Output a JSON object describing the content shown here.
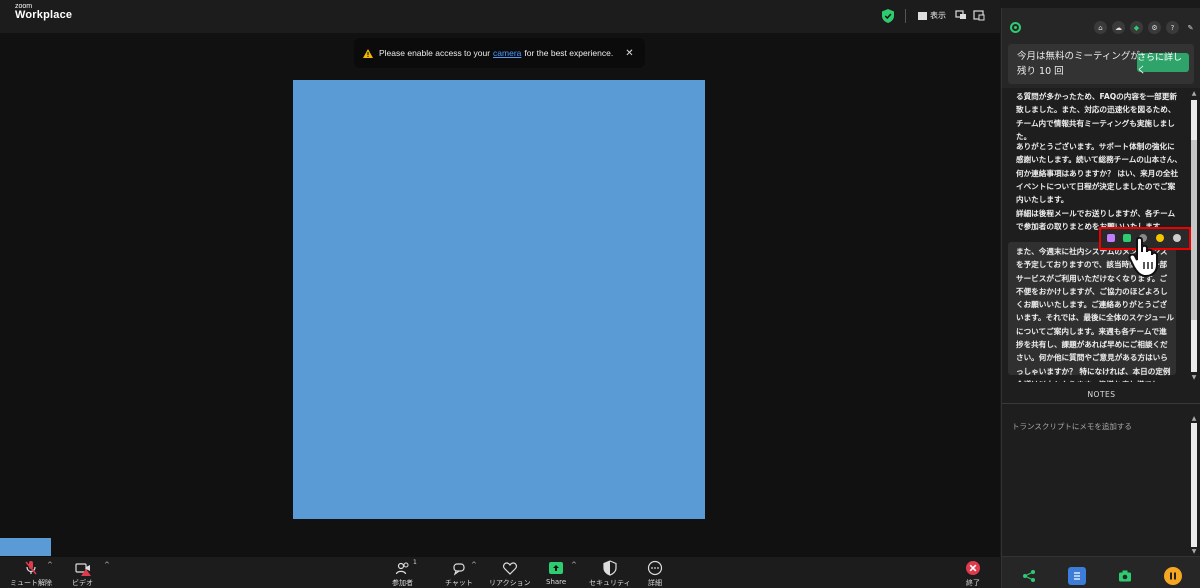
{
  "topbar": {
    "brand_small": "zoom",
    "brand_big": "Workplace",
    "view_label": "表示"
  },
  "notice": {
    "text_before": "Please enable access to your",
    "link": "camera",
    "text_after": "for the best experience.",
    "close": "✕"
  },
  "toolbar": {
    "mute_label": "ミュート解除",
    "video_label": "ビデオ",
    "participants_label": "参加者",
    "participants_count": "1",
    "chat_label": "チャット",
    "reaction_label": "リアクション",
    "share_label": "Share",
    "security_label": "セキュリティ",
    "more_label": "詳細",
    "end_label": "終了"
  },
  "panel": {
    "promo_line1": "今月は無料のミーティングが",
    "promo_line2": "残り 10 回",
    "promo_button": "さらに詳しく",
    "transcript": [
      "る質問が多かったため、FAQの内容を一部更新致しました。また、対応の迅速化を図るため、チーム内で情報共有ミーティングも実施しました。",
      "ありがとうございます。サポート体制の強化に感謝いたします。続いて総務チームの山本さん、何か連絡事項はありますか？ はい、来月の全社イベントについて日程が決定しましたのでご案内いたします。",
      "詳細は後程メールでお送りしますが、各チームで参加者の取りまとめをお願いいたします。",
      "また、今週末に社内システムのメンテナンスを予定しておりますので、該当時間帯は一部サービスがご利用いただけなくなります。ご不便をおかけしますが、ご協力のほどよろしくお願いいたします。ご連絡ありがとうございます。それでは、最後に全体のスケジュールについてご案内します。来週も各チームで進捗を共有し、課題があれば早めにご相談ください。何か他に質問やご意見がある方はいらっしゃいますか？ 特になければ、本日の定例会議は以上となります。皆様お疲れ様でした。"
    ],
    "notes_label": "NOTES",
    "notes_placeholder": "トランスクリプトにメモを追加する"
  },
  "colors": {
    "screen_share": "#5b9bd5",
    "accent_green": "#2ea36a",
    "highlight_red": "#e00000",
    "link_blue": "#4e9bff"
  }
}
